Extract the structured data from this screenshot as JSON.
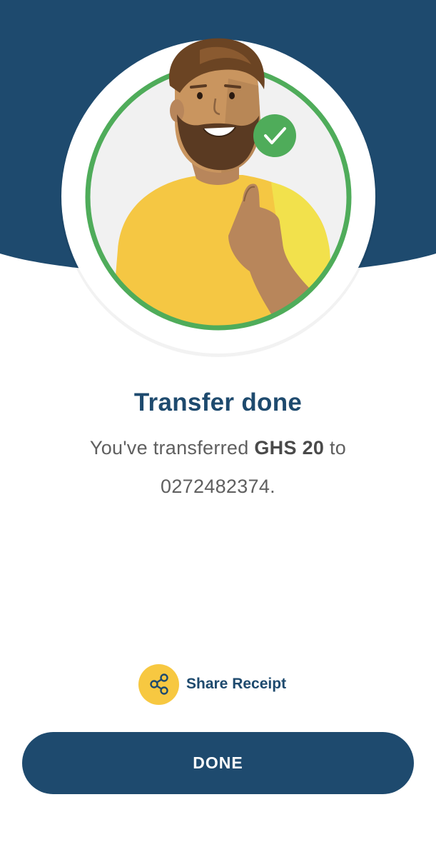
{
  "header": {
    "bg_color": "#1e4a6e"
  },
  "illustration": {
    "name": "man-thumbs-up-with-checkmark",
    "ring_color": "#4fac5a",
    "check_color": "#4fac5a"
  },
  "status": {
    "title": "Transfer done",
    "message_prefix": "You've transferred ",
    "amount": "GHS 20",
    "message_middle": " to",
    "recipient": "0272482374."
  },
  "share": {
    "label": "Share Receipt",
    "icon": "share-icon",
    "icon_bg": "#f7c841"
  },
  "done_button": {
    "label": "DONE",
    "color": "#1e4a6e"
  }
}
